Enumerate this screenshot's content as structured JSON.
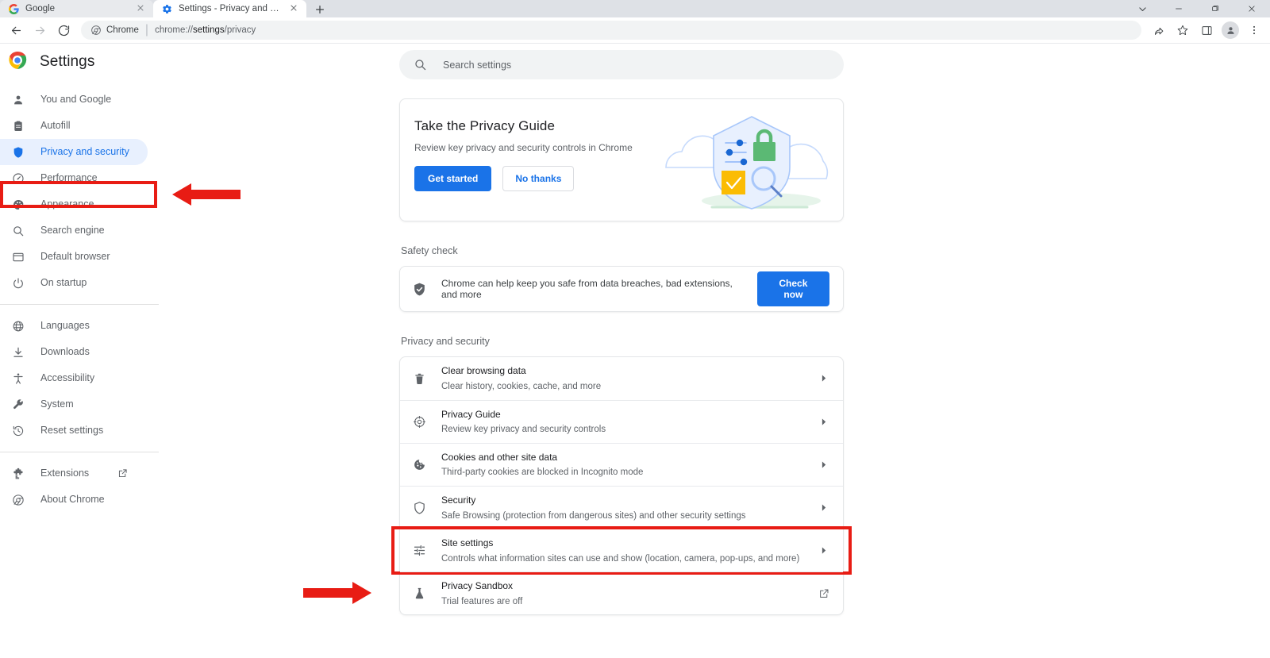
{
  "window": {
    "controls": [
      {
        "name": "tab-search-button",
        "glyph": "chevron-down"
      },
      {
        "name": "minimize-button",
        "glyph": "minimize"
      },
      {
        "name": "maximize-button",
        "glyph": "maximize"
      },
      {
        "name": "close-button",
        "glyph": "close"
      }
    ]
  },
  "tabs": [
    {
      "title": "Google",
      "favicon": "google-icon",
      "active": false
    },
    {
      "title": "Settings - Privacy and security",
      "favicon": "settings-gear-icon",
      "active": true
    }
  ],
  "new_tab_label": "+",
  "toolbar": {
    "back_label": "Back",
    "forward_label": "Forward",
    "reload_label": "Reload",
    "omnibox": {
      "chip_label": "Chrome",
      "url_prefix": "chrome://",
      "url_bold": "settings",
      "url_suffix": "/privacy",
      "full_url": "chrome://settings/privacy"
    },
    "right_icons": [
      "share-icon",
      "bookmark-star-icon",
      "side-panel-icon",
      "profile-avatar-icon",
      "chrome-menu-icon"
    ]
  },
  "sidebar": {
    "brand": "Settings",
    "items": [
      {
        "label": "You and Google",
        "icon": "person-icon",
        "selected": false
      },
      {
        "label": "Autofill",
        "icon": "clipboard-icon",
        "selected": false
      },
      {
        "label": "Privacy and security",
        "icon": "shield-icon",
        "selected": true
      },
      {
        "label": "Performance",
        "icon": "speedometer-icon",
        "selected": false
      },
      {
        "label": "Appearance",
        "icon": "palette-icon",
        "selected": false
      },
      {
        "label": "Search engine",
        "icon": "magnifier-icon",
        "selected": false
      },
      {
        "label": "Default browser",
        "icon": "browser-window-icon",
        "selected": false
      },
      {
        "label": "On startup",
        "icon": "power-icon",
        "selected": false
      }
    ],
    "items_group2": [
      {
        "label": "Languages",
        "icon": "globe-icon"
      },
      {
        "label": "Downloads",
        "icon": "download-icon"
      },
      {
        "label": "Accessibility",
        "icon": "accessibility-icon"
      },
      {
        "label": "System",
        "icon": "wrench-icon"
      },
      {
        "label": "Reset settings",
        "icon": "history-restore-icon"
      }
    ],
    "items_group3": [
      {
        "label": "Extensions",
        "icon": "puzzle-icon",
        "external": true
      },
      {
        "label": "About Chrome",
        "icon": "chrome-icon",
        "external": false
      }
    ]
  },
  "search": {
    "placeholder": "Search settings",
    "value": "",
    "icon": "search-icon"
  },
  "promo": {
    "title": "Take the Privacy Guide",
    "subtitle": "Review key privacy and security controls in Chrome",
    "primary_button": "Get started",
    "secondary_button": "No thanks",
    "illustration": "privacy-shield-clouds-illustration"
  },
  "safety_check": {
    "section_label": "Safety check",
    "icon": "shield-check-icon",
    "text": "Chrome can help keep you safe from data breaches, bad extensions, and more",
    "button": "Check now"
  },
  "privacy_section": {
    "section_label": "Privacy and security",
    "rows": [
      {
        "icon": "trash-icon",
        "title": "Clear browsing data",
        "subtitle": "Clear history, cookies, cache, and more",
        "trailing": "chevron",
        "highlighted": false
      },
      {
        "icon": "privacy-guide-icon",
        "title": "Privacy Guide",
        "subtitle": "Review key privacy and security controls",
        "trailing": "chevron",
        "highlighted": false
      },
      {
        "icon": "cookie-icon",
        "title": "Cookies and other site data",
        "subtitle": "Third-party cookies are blocked in Incognito mode",
        "trailing": "chevron",
        "highlighted": false
      },
      {
        "icon": "security-shield-icon",
        "title": "Security",
        "subtitle": "Safe Browsing (protection from dangerous sites) and other security settings",
        "trailing": "chevron",
        "highlighted": false
      },
      {
        "icon": "sliders-icon",
        "title": "Site settings",
        "subtitle": "Controls what information sites can use and show (location, camera, pop-ups, and more)",
        "trailing": "chevron",
        "highlighted": true
      },
      {
        "icon": "flask-icon",
        "title": "Privacy Sandbox",
        "subtitle": "Trial features are off",
        "trailing": "external-link",
        "highlighted": false
      }
    ]
  },
  "annotations": {
    "arrow_color": "#e81c14",
    "highlight_color": "#e81c14",
    "arrows": [
      {
        "name": "arrow-pointing-to-privacy-and-security",
        "direction": "left"
      },
      {
        "name": "arrow-pointing-to-site-settings",
        "direction": "right"
      }
    ]
  },
  "colors": {
    "accent": "#1a73e8",
    "selected_nav_bg": "#e8f0fe",
    "tabstrip_bg": "#dee1e6",
    "omnibox_bg": "#f1f3f4"
  }
}
